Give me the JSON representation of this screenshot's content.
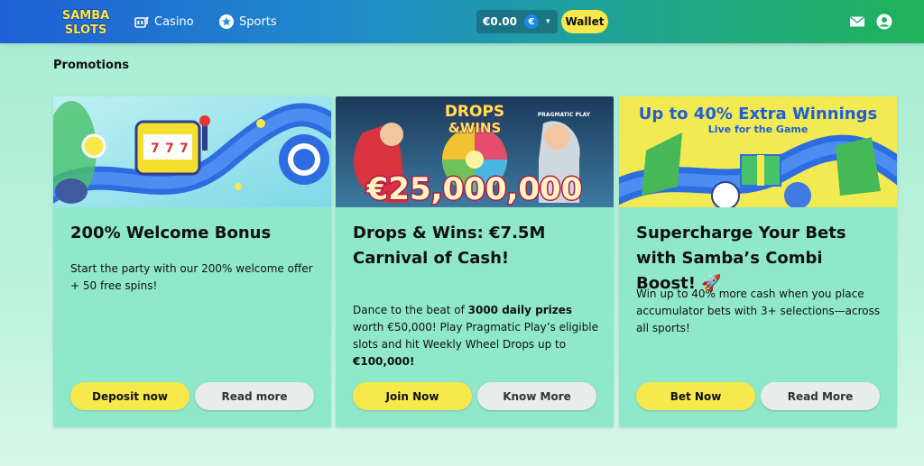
{
  "header": {
    "logo_text": [
      "SAMBA",
      "SLOTS"
    ],
    "nav": [
      {
        "label": "Casino",
        "icon": "casino-icon"
      },
      {
        "label": "Sports",
        "icon": "sports-star-icon"
      }
    ],
    "balance": "€0.00",
    "currency_symbol": "€",
    "wallet_label": "Wallet"
  },
  "section_title": "Promotions",
  "cards": [
    {
      "title": "200% Welcome Bonus",
      "desc": "Start the party with our 200% welcome offer + 50 free spins!",
      "primary": "Deposit now",
      "secondary": "Read more"
    },
    {
      "title": "Drops & Wins: €7.5M Carnival of Cash!",
      "desc_parts": [
        "Dance to the beat of ",
        "3000 daily prizes",
        " worth €50,000! Play Pragmatic Play’s eligible slots and hit Weekly Wheel Drops up to ",
        "€100,000!"
      ],
      "banner_heading": [
        "DROPS",
        "&WINS"
      ],
      "banner_amount": "€25,000,000",
      "banner_brand": "PRAGMATIC PLAY",
      "primary": "Join Now",
      "secondary": "Know More"
    },
    {
      "title": "Supercharge Your Bets with Samba’s Combi Boost! 🚀",
      "desc": "Win up to 40% more cash when you place accumulator bets with 3+ selections—across all sports!",
      "banner_heading": "Up to 40% Extra Winnings",
      "banner_sub": "Live for the Game",
      "primary": "Bet Now",
      "secondary": "Read More"
    }
  ],
  "colors": {
    "accent_yellow": "#f7e84b",
    "card_bg": "#8fe8c9",
    "page_bg": "#a7ecd3"
  }
}
